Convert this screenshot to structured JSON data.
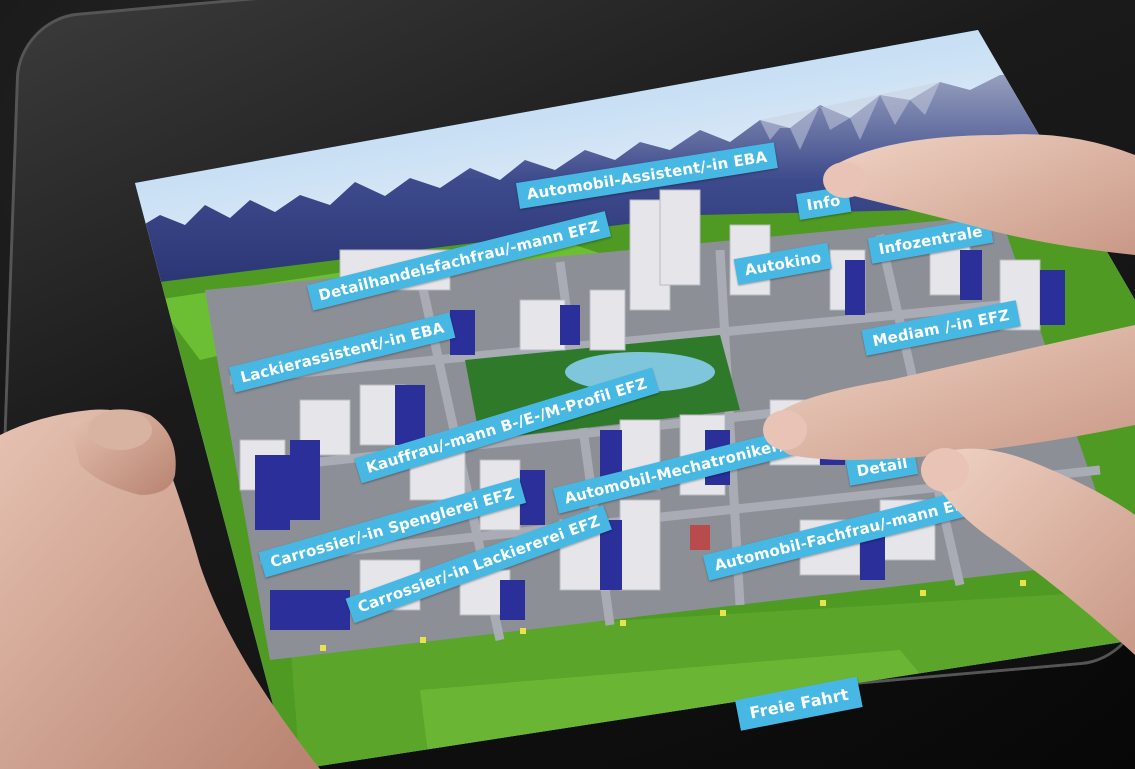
{
  "labels": {
    "automobil_assistent": "Automobil-Assistent/-in EBA",
    "info_partial": "Info",
    "detailhandel": "Detailhandelsfachfrau/-mann EFZ",
    "autokino": "Autokino",
    "infozentrale": "Infozentrale",
    "mediamatiker_partial": "Mediam       /-in EFZ",
    "lackierassistent": "Lackierassistent/-in EBA",
    "kauffrau": "Kauffrau/-mann B-/E-/M-Profil EFZ",
    "mechatroniker_partial": "Automobil-Mechatroniker/",
    "detail_partial": "Detail",
    "carrossier_spenglerei": "Carrossier/-in Spenglerei EFZ",
    "carrossier_lackiererei": "Carrossier/-in Lackiererei EFZ",
    "automobil_fachfrau": "Automobil-Fachfrau/-mann EF",
    "freie_fahrt": "Freie Fahrt"
  },
  "colors": {
    "label_bg": "#47b8e3",
    "label_text": "#ffffff",
    "grass": "#5faa2a",
    "sky": "#9cc7ef",
    "building_blue": "#2b2f9a",
    "building_white": "#e6e6ea"
  }
}
